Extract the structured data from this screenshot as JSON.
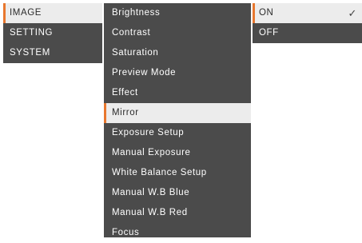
{
  "menu": {
    "categories": [
      {
        "label": "IMAGE",
        "selected": true
      },
      {
        "label": "SETTING",
        "selected": false
      },
      {
        "label": "SYSTEM",
        "selected": false
      }
    ],
    "options": [
      {
        "label": "Brightness",
        "selected": false
      },
      {
        "label": "Contrast",
        "selected": false
      },
      {
        "label": "Saturation",
        "selected": false
      },
      {
        "label": "Preview Mode",
        "selected": false
      },
      {
        "label": "Effect",
        "selected": false
      },
      {
        "label": "Mirror",
        "selected": true
      },
      {
        "label": "Exposure Setup",
        "selected": false
      },
      {
        "label": "Manual Exposure",
        "selected": false
      },
      {
        "label": "White Balance Setup",
        "selected": false
      },
      {
        "label": "Manual W.B Blue",
        "selected": false
      },
      {
        "label": "Manual W.B Red",
        "selected": false
      },
      {
        "label": "Focus",
        "selected": false
      }
    ],
    "values": [
      {
        "label": "ON",
        "selected": true,
        "checked": true
      },
      {
        "label": "OFF",
        "selected": false,
        "checked": false
      }
    ],
    "check_glyph": "✓"
  },
  "colors": {
    "panel": "#4b4b4b",
    "highlight": "#ececec",
    "accent": "#e8772e"
  },
  "icons": {
    "checked": "checkmark-icon"
  }
}
